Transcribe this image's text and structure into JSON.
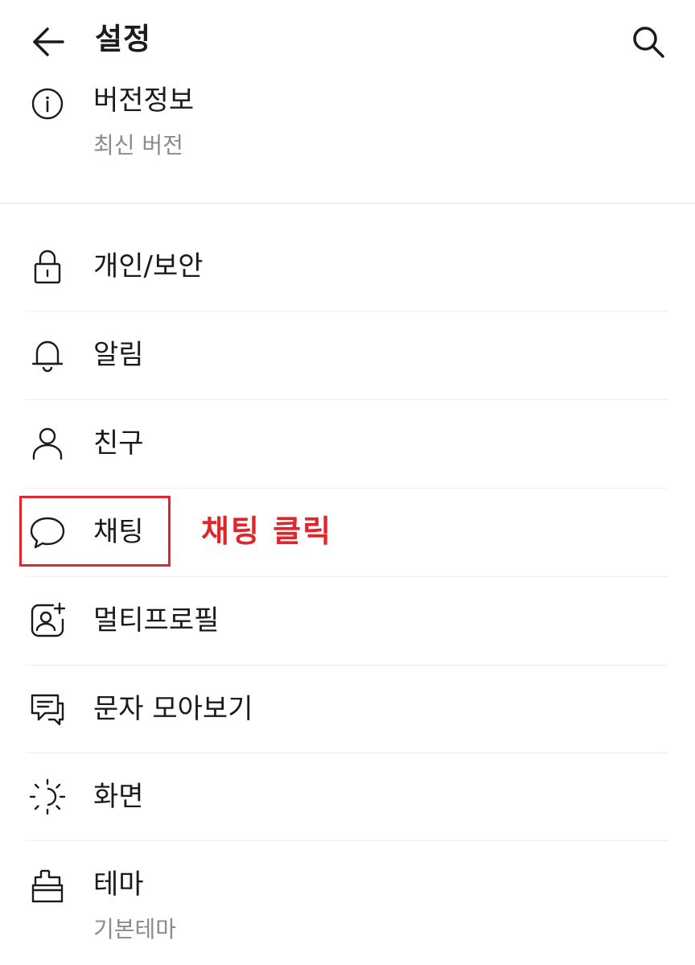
{
  "header": {
    "back_icon": "arrow-left-icon",
    "title": "설정",
    "search_icon": "search-icon"
  },
  "version": {
    "icon": "info-icon",
    "label": "버전정보",
    "status": "최신 버전"
  },
  "settings": {
    "items": [
      {
        "id": "privacy",
        "label": "개인/보안",
        "icon": "lock-icon"
      },
      {
        "id": "notifications",
        "label": "알림",
        "icon": "bell-icon"
      },
      {
        "id": "friends",
        "label": "친구",
        "icon": "person-icon"
      },
      {
        "id": "chatting",
        "label": "채팅",
        "icon": "chat-bubble-icon"
      },
      {
        "id": "multi-profile",
        "label": "멀티프로필",
        "icon": "add-profile-icon"
      },
      {
        "id": "sms",
        "label": "문자 모아보기",
        "icon": "messages-icon"
      },
      {
        "id": "display",
        "label": "화면",
        "icon": "brightness-icon"
      },
      {
        "id": "theme",
        "label": "테마",
        "sub": "기본테마",
        "icon": "brush-icon"
      }
    ]
  },
  "annotation": {
    "text": "채팅 클릭",
    "color": "#e0262a"
  }
}
